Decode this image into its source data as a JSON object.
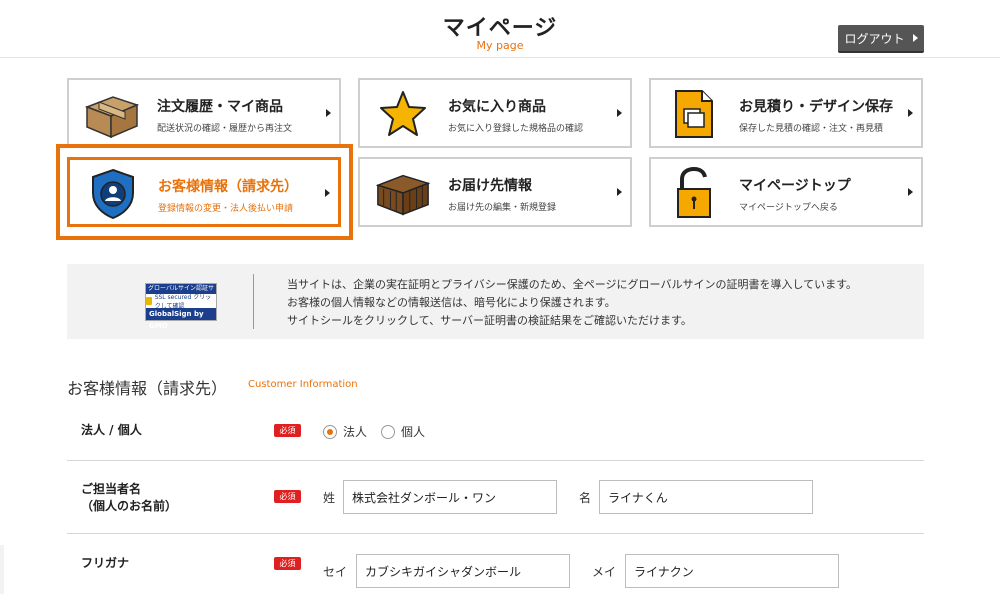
{
  "header": {
    "title": "マイページ",
    "subtitle": "My page",
    "logout_label": "ログアウト"
  },
  "menu": [
    {
      "title": "注文履歴・マイ商品",
      "sub": "配送状況の確認・履歴から再注文",
      "icon": "cardboard-box-icon"
    },
    {
      "title": "お気に入り商品",
      "sub": "お気に入り登録した規格品の確認",
      "icon": "star-icon"
    },
    {
      "title": "お見積り・デザイン保存",
      "sub": "保存した見積の確認・注文・再見積",
      "icon": "document-icon"
    },
    {
      "title": "お客様情報（請求先）",
      "sub": "登録情報の変更・法人後払い申請",
      "icon": "shield-user-icon",
      "active": true
    },
    {
      "title": "お届け先情報",
      "sub": "お届け先の編集・新規登録",
      "icon": "box-stack-icon"
    },
    {
      "title": "マイページトップ",
      "sub": "マイページトップへ戻る",
      "icon": "padlock-icon"
    }
  ],
  "security": {
    "seal_top": "グローバルサイン認証サイト",
    "seal_mid": "SSL secured クリックして確認",
    "seal_bottom": "GlobalSign by GMO",
    "line1": "当サイトは、企業の実在証明とプライバシー保護のため、全ページにグローバルサインの証明書を導入しています。",
    "line2": "お客様の個人情報などの情報送信は、暗号化により保護されます。",
    "line3": "サイトシールをクリックして、サーバー証明書の検証結果をご確認いただけます。"
  },
  "section": {
    "title": "お客様情報（請求先）",
    "title_en": "Customer Information"
  },
  "form": {
    "required_label": "必須",
    "type": {
      "label": "法人 / 個人",
      "option_corp": "法人",
      "option_personal": "個人",
      "selected": "法人"
    },
    "name": {
      "label_line1": "ご担当者名",
      "label_line2": "（個人のお名前）",
      "sei_label": "姓",
      "sei_value": "株式会社ダンボール・ワン",
      "mei_label": "名",
      "mei_value": "ライナくん"
    },
    "kana": {
      "label": "フリガナ",
      "sei_label": "セイ",
      "sei_value": "カブシキガイシャダンボール",
      "mei_label": "メイ",
      "mei_value": "ライナクン"
    }
  },
  "colors": {
    "accent": "#e8720c",
    "required": "#e02020",
    "logout_bg": "#555555"
  }
}
